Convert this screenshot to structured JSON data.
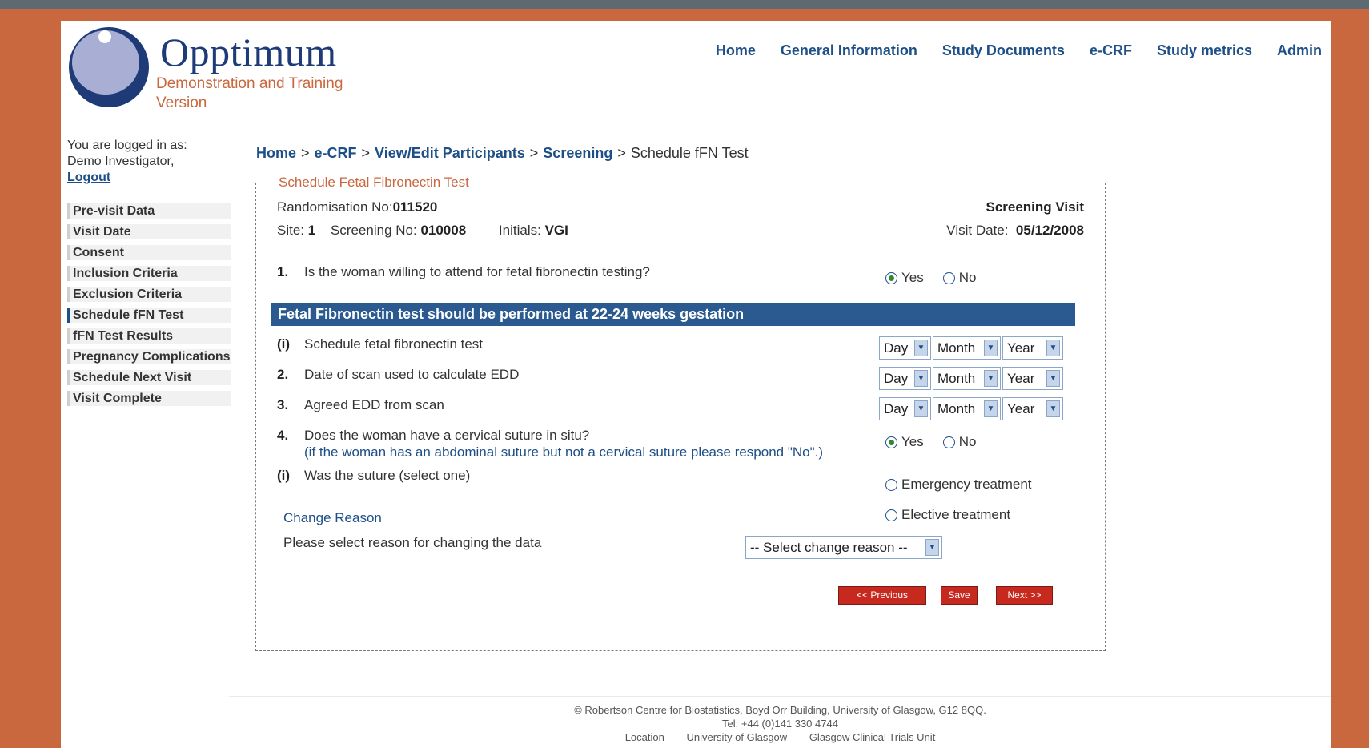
{
  "brand": {
    "name": "Opptimum",
    "subtitle_line1": "Demonstration and Training",
    "subtitle_line2": "Version"
  },
  "nav": [
    {
      "label": "Home"
    },
    {
      "label": "General Information"
    },
    {
      "label": "Study Documents"
    },
    {
      "label": "e-CRF"
    },
    {
      "label": "Study metrics"
    },
    {
      "label": "Admin"
    }
  ],
  "user": {
    "logged_in_as": "You are logged in as:",
    "name": "Demo Investigator,",
    "logout": "Logout"
  },
  "sidebar": [
    {
      "label": "Pre-visit Data",
      "active": false
    },
    {
      "label": "Visit Date",
      "active": false
    },
    {
      "label": "Consent",
      "active": false
    },
    {
      "label": "Inclusion Criteria",
      "active": false
    },
    {
      "label": "Exclusion Criteria",
      "active": false
    },
    {
      "label": "Schedule fFN Test",
      "active": true
    },
    {
      "label": "fFN Test Results",
      "active": false
    },
    {
      "label": "Pregnancy Complications",
      "active": false
    },
    {
      "label": "Schedule Next Visit",
      "active": false
    },
    {
      "label": "Visit Complete",
      "active": false
    }
  ],
  "breadcrumb": {
    "home": "Home",
    "ecrf": "e-CRF",
    "participants": "View/Edit Participants",
    "screening": "Screening",
    "current": "Schedule fFN Test",
    "sep": ">"
  },
  "form": {
    "legend": "Schedule Fetal Fibronectin Test",
    "rand_label": "Randomisation No:",
    "rand_value": "011520",
    "visit_type": "Screening Visit",
    "site_label": "Site:",
    "site_value": "1",
    "screening_label": "Screening No:",
    "screening_value": "010008",
    "initials_label": "Initials:",
    "initials_value": "VGI",
    "visit_date_label": "Visit Date:",
    "visit_date_value": "05/12/2008",
    "banner": "Fetal Fibronectin test should be performed at 22-24 weeks gestation",
    "q1": {
      "num": "1.",
      "text": "Is the woman willing to attend for fetal fibronectin testing?",
      "yes": "Yes",
      "no": "No",
      "selected": "Yes"
    },
    "qi": {
      "num": "(i)",
      "text": "Schedule fetal fibronectin test"
    },
    "q2": {
      "num": "2.",
      "text": "Date of scan used to calculate EDD"
    },
    "q3": {
      "num": "3.",
      "text": "Agreed EDD from scan"
    },
    "q4": {
      "num": "4.",
      "text": "Does the woman have a cervical suture in situ?",
      "hint": "(if the woman has an abdominal suture but not a cervical suture please respond \"No\".)",
      "yes": "Yes",
      "no": "No",
      "selected": "Yes"
    },
    "q4i": {
      "num": "(i)",
      "text": "Was the suture (select one)",
      "opt1": "Emergency treatment",
      "opt2": "Elective treatment"
    },
    "date_select": {
      "day": "Day",
      "month": "Month",
      "year": "Year"
    },
    "change_reason_title": "Change Reason",
    "change_reason_label": "Please select reason for changing the data",
    "change_reason_select": "-- Select change reason --",
    "btn_prev": "<< Previous",
    "btn_save": "Save",
    "btn_next": "Next >>"
  },
  "footer": {
    "line1": "© Robertson Centre for Biostatistics, Boyd Orr Building, University of Glasgow, G12 8QQ.",
    "line2": "Tel: +44 (0)141 330 4744",
    "links": [
      "Location",
      "University of Glasgow",
      "Glasgow Clinical Trials Unit"
    ]
  },
  "colors": {
    "frame": "#c9673e",
    "navy": "#1e4f87",
    "banner": "#2a5a8f",
    "button": "#c8291e"
  }
}
